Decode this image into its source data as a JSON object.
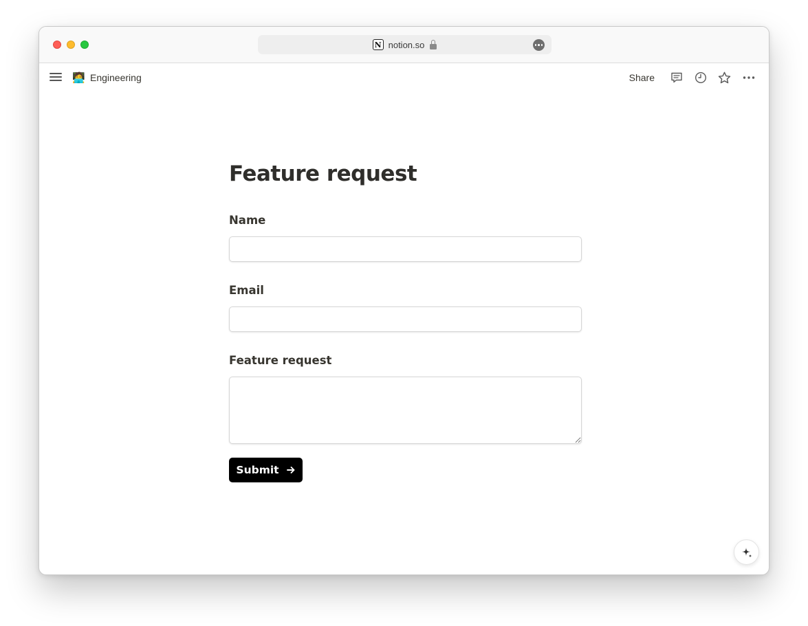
{
  "browser": {
    "url": "notion.so"
  },
  "topbar": {
    "breadcrumb_emoji": "🧑‍💻",
    "breadcrumb_label": "Engineering",
    "share_label": "Share",
    "icons": [
      "menu-icon",
      "comment-icon",
      "history-icon",
      "star-icon",
      "more-icon"
    ]
  },
  "form": {
    "title": "Feature request",
    "fields": [
      {
        "label": "Name",
        "value": "",
        "placeholder": ""
      },
      {
        "label": "Email",
        "value": "",
        "placeholder": ""
      },
      {
        "label": "Feature request",
        "value": "",
        "placeholder": ""
      }
    ],
    "submit_label": "Submit"
  },
  "colors": {
    "submit_background": "#000000",
    "title_text": "#2f2e2b"
  }
}
